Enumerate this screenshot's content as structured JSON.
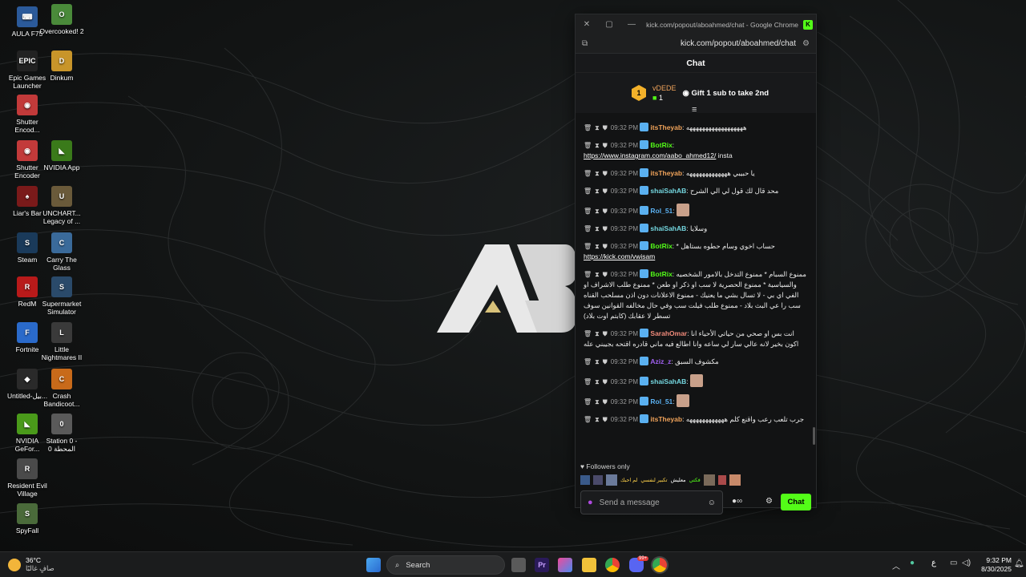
{
  "desktop_icons": [
    {
      "label": "AULA F75",
      "color": "#2b5a9a",
      "glyph": "⌨"
    },
    {
      "label": "Overcooked! 2",
      "color": "#4a8a3a",
      "glyph": "O"
    },
    {
      "label": "Epic Games Launcher",
      "color": "#222222",
      "glyph": "EPIC"
    },
    {
      "label": "Dinkum",
      "color": "#c8952a",
      "glyph": "D"
    },
    {
      "label": "Shutter Encod...",
      "color": "#c23a3a",
      "glyph": "◉"
    },
    {
      "label": "Shutter Encoder",
      "color": "#c23a3a",
      "glyph": "◉"
    },
    {
      "label": "NVIDIA App",
      "color": "#3a7a1a",
      "glyph": "◣"
    },
    {
      "label": "Liar's Bar",
      "color": "#7a1a1a",
      "glyph": "♠"
    },
    {
      "label": "UNCHART... Legacy of ...",
      "color": "#6a5a3a",
      "glyph": "U"
    },
    {
      "label": "Steam",
      "color": "#1a3a5a",
      "glyph": "S"
    },
    {
      "label": "Carry The Glass",
      "color": "#3a6a9a",
      "glyph": "C"
    },
    {
      "label": "RedM",
      "color": "#b81a1a",
      "glyph": "R"
    },
    {
      "label": "Supermarket Simulator",
      "color": "#2a4a6a",
      "glyph": "S"
    },
    {
      "label": "Fortnite",
      "color": "#2a6aca",
      "glyph": "F"
    },
    {
      "label": "Little Nightmares II",
      "color": "#3a3a3a",
      "glyph": "L"
    },
    {
      "label": "Untitled-بيل...",
      "color": "#2a2a2a",
      "glyph": "◆"
    },
    {
      "label": "Crash Bandicoot...",
      "color": "#c86a1a",
      "glyph": "C"
    },
    {
      "label": "NVIDIA GeFor...",
      "color": "#4a9a1a",
      "glyph": "◣"
    },
    {
      "label": "Station 0 - المحطة 0",
      "color": "#5a5a5a",
      "glyph": "0"
    },
    {
      "label": "Resident Evil Village",
      "color": "#4a4a4a",
      "glyph": "R"
    },
    {
      "label": "SpyFall",
      "color": "#4a6a3a",
      "glyph": "S"
    }
  ],
  "browser": {
    "title": "kick.com/popout/aboahmed/chat - Google Chrome",
    "url": "kick.com/popout/aboahmed/chat"
  },
  "chat": {
    "header": "Chat",
    "pinned": {
      "rank": "1",
      "user": "vDEDE",
      "count": "1",
      "gift_text": "Gift 1 sub to take 2nd"
    },
    "messages": [
      {
        "time": "09:32 PM",
        "user": "itsTheyab",
        "color": "#f0a35a",
        "text": "ههههههههههههههههههه"
      },
      {
        "time": "09:32 PM",
        "user": "BotRix",
        "color": "#53fc18",
        "text": "",
        "link": "https://www.instagram.com/aabo_ahmed12/",
        "after": "insta"
      },
      {
        "time": "09:32 PM",
        "user": "itsTheyab",
        "color": "#f0a35a",
        "text": "يا حبيبي هههههههههههههه"
      },
      {
        "time": "09:32 PM",
        "user": "shaiSahAB",
        "color": "#74d7e0",
        "text": "محد قال لك قول لي الي الشرح"
      },
      {
        "time": "09:32 PM",
        "user": "Rol_51",
        "color": "#5ab0f0",
        "text": ""
      },
      {
        "time": "09:32 PM",
        "user": "shaiSahAB",
        "color": "#74d7e0",
        "text": "وسلايا"
      },
      {
        "time": "09:32 PM",
        "user": "BotRix",
        "color": "#53fc18",
        "text": "* حساب اخوي وسام حطوه بستاهل",
        "link": "https://kick.com/vwisam",
        "after": ""
      },
      {
        "time": "09:32 PM",
        "user": "BotRix",
        "color": "#53fc18",
        "text": "ممنوع السبام * ممنوع التدخل بالامور الشخصيه والسياسية * ممنوع الحصرية لا سب او ذكر او طعن * ممنوع طلب الاشراف او الفي اي بي - لا تسال بشي ما يعنيك - ممنوع الاعلانات دون اذن مسلحب القناه سب را عي البث بلاد - ممنوع طلب فيلت سب وفي حال مخالفه القوانين سوف تسطر لا عقابك (كابتم اوت بلاد)"
      },
      {
        "time": "09:32 PM",
        "user": "SarahOmar",
        "color": "#f08a7a",
        "text": "انت بس او صحي من حياتي الأحياء انا اكون بخير لانه عالي سار لي ساعه وانا اطالع فيه ماني قادره اقتحه بجيبني عله"
      },
      {
        "time": "09:32 PM",
        "user": "Aziz_z",
        "color": "#a060f0",
        "text": "مكشوف السبق"
      },
      {
        "time": "09:32 PM",
        "user": "shaiSahAB",
        "color": "#74d7e0",
        "text": ""
      },
      {
        "time": "09:32 PM",
        "user": "Rol_51",
        "color": "#5ab0f0",
        "text": ""
      },
      {
        "time": "09:32 PM",
        "user": "itsTheyab",
        "color": "#f0a35a",
        "text": "جرب تلعب رعب واقنع كلم ههههههههههههه"
      }
    ],
    "followers_only": "Followers only",
    "emote_texts": [
      "لم احبك",
      "تكبير لنفسي",
      "معليش",
      "فكتي"
    ],
    "input_placeholder": "Send a message",
    "send_label": "Chat"
  },
  "taskbar": {
    "weather_temp": "36°C",
    "weather_desc": "صافٍ غالبًا",
    "search_placeholder": "Search",
    "lang": "ع",
    "time": "9:32 PM",
    "date": "8/30/2025",
    "badge": "99+"
  }
}
